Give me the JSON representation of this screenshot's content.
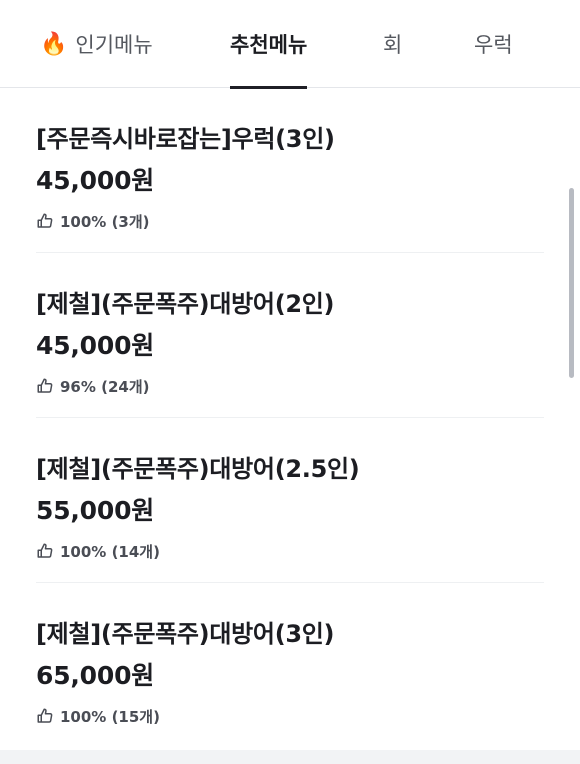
{
  "tabs": [
    {
      "icon": "fire-icon",
      "emoji": "🔥",
      "label": "인기메뉴",
      "active": false
    },
    {
      "label": "추천메뉴",
      "active": true
    },
    {
      "label": "회",
      "active": false
    },
    {
      "label": "우럭",
      "active": false
    }
  ],
  "menu_items": [
    {
      "name": "[주문즉시바로잡는]우럭(3인)",
      "price": "45,000원",
      "rating": "100% (3개)"
    },
    {
      "name": "[제철](주문폭주)대방어(2인)",
      "price": "45,000원",
      "rating": "96% (24개)"
    },
    {
      "name": "[제철](주문폭주)대방어(2.5인)",
      "price": "55,000원",
      "rating": "100% (14개)"
    },
    {
      "name": "[제철](주문폭주)대방어(3인)",
      "price": "65,000원",
      "rating": "100% (15개)"
    }
  ],
  "colors": {
    "text": "#1c1d22",
    "muted": "#55585f",
    "divider": "#eef0f2",
    "active_underline": "#1f1f26"
  }
}
